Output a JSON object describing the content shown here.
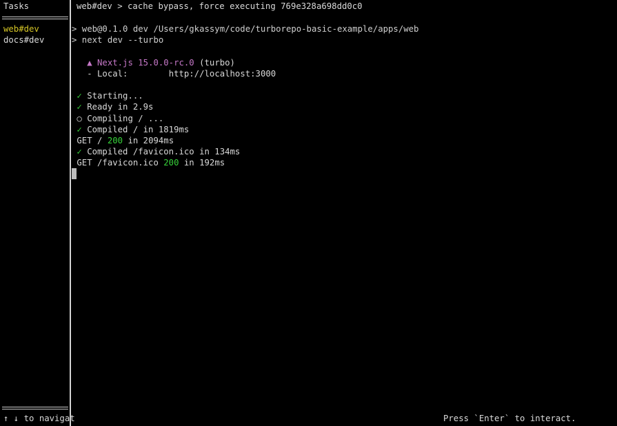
{
  "sidebar": {
    "title": "Tasks",
    "tasks": [
      {
        "label": "web#dev",
        "selected": true
      },
      {
        "label": "docs#dev",
        "selected": false
      }
    ],
    "footer": "↑ ↓ to navigat"
  },
  "pane": {
    "header": "web#dev > cache bypass, force executing 769e328a698dd0c0",
    "command_lines": [
      "> web@0.1.0 dev /Users/gkassym/code/turborepo-basic-example/apps/web",
      "> next dev --turbo"
    ],
    "next_banner": {
      "mark": "▲",
      "name": "Next.js 15.0.0-rc.0",
      "suffix": "(turbo)"
    },
    "local": {
      "label": "- Local:",
      "url": "http://localhost:3000"
    },
    "log": [
      {
        "symbol": "✓",
        "text": "Starting..."
      },
      {
        "symbol": "✓",
        "text": "Ready in 2.9s"
      },
      {
        "symbol": "○",
        "text": "Compiling / ..."
      },
      {
        "symbol": "✓",
        "text": "Compiled / in 1819ms"
      }
    ],
    "request_1": {
      "method_path": "GET /",
      "status": "200",
      "timing": "in 2094ms"
    },
    "compiled_favicon": {
      "symbol": "✓",
      "text": "Compiled /favicon.ico in 134ms"
    },
    "request_2": {
      "method_path": "GET /favicon.ico",
      "status": "200",
      "timing": "in 192ms"
    }
  },
  "footer_hint": "Press `Enter` to interact.",
  "colors": {
    "selected_task": "#d6c626",
    "next_brand": "#c678c8",
    "success": "#37d33a"
  }
}
